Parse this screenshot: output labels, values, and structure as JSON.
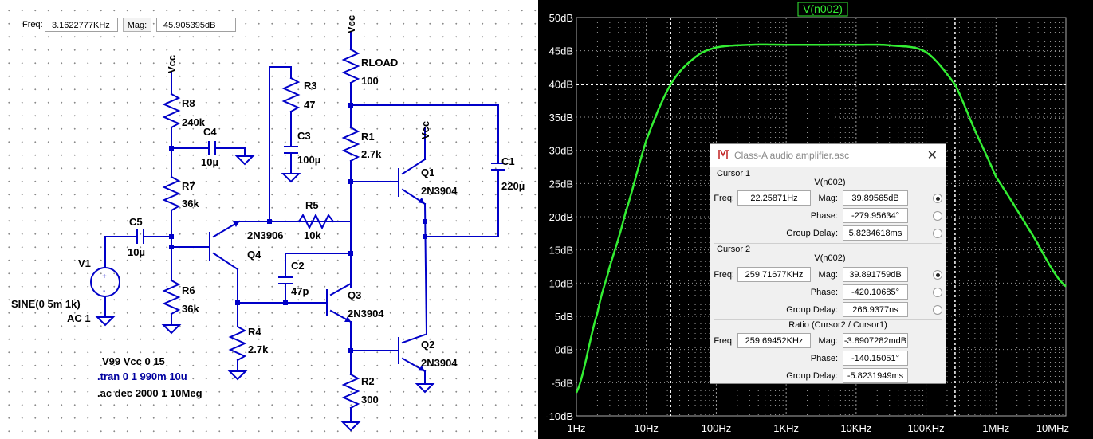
{
  "toolbar": {
    "freq_label": "Freq:",
    "freq_value": "3.1622777KHz",
    "mag_label": "Mag:",
    "mag_value": "45.905395dB"
  },
  "schematic": {
    "labels": {
      "vcc1": "Vcc",
      "vcc2": "Vcc",
      "vcc3": "Vcc",
      "r8": "R8",
      "r8v": "240k",
      "c4": "C4",
      "c4v": "10µ",
      "r7": "R7",
      "r7v": "36k",
      "r6": "R6",
      "r6v": "36k",
      "c5": "C5",
      "c5v": "10µ",
      "v1": "V1",
      "v1s": "SINE(0 5m 1k)",
      "v1a": "AC 1",
      "q4": "Q4",
      "q4m": "2N3906",
      "r4": "R4",
      "r4v": "2.7k",
      "r3": "R3",
      "r3v": "47",
      "c3": "C3",
      "c3v": "100µ",
      "r5": "R5",
      "r5v": "10k",
      "c2": "C2",
      "c2v": "47p",
      "rload": "RLOAD",
      "rloadv": "100",
      "r1": "R1",
      "r1v": "2.7k",
      "q1": "Q1",
      "q1m": "2N3904",
      "q3": "Q3",
      "q3m": "2N3904",
      "q2": "Q2",
      "q2m": "2N3904",
      "r2": "R2",
      "r2v": "300",
      "c1": "C1",
      "c1v": "220µ"
    },
    "directives": {
      "supply": "V99 Vcc 0 15",
      "tran": ".tran 0 1 990m 10u",
      "ac": ".ac dec 2000 1 10Meg"
    }
  },
  "plot": {
    "trace_label": "V(n002)",
    "y_ticks": [
      "50dB",
      "45dB",
      "40dB",
      "35dB",
      "30dB",
      "25dB",
      "20dB",
      "15dB",
      "10dB",
      "5dB",
      "0dB",
      "-5dB",
      "-10dB"
    ],
    "x_ticks": [
      "1Hz",
      "10Hz",
      "100Hz",
      "1KHz",
      "10KHz",
      "100KHz",
      "1MHz",
      "10MHz"
    ],
    "colors": {
      "background": "#000000",
      "trace": "#33ee33",
      "grid": "#9a9a9a",
      "cursor": "#ffffff"
    }
  },
  "chart_data": {
    "type": "line",
    "xscale": "log",
    "xlim": [
      1,
      10000000
    ],
    "ylim": [
      -10,
      50
    ],
    "series": [
      {
        "name": "V(n002)",
        "x": [
          1,
          2,
          3,
          5,
          10,
          22.26,
          50,
          100,
          316.2,
          1000,
          3162,
          10000,
          31620,
          100000,
          259700.0,
          500000,
          1000000,
          3000000,
          10000000
        ],
        "y": [
          -6.5,
          5.5,
          12.5,
          20.5,
          31.5,
          39.9,
          44.0,
          45.5,
          45.9,
          45.9,
          45.9,
          45.9,
          45.8,
          44.8,
          39.9,
          33.0,
          26.0,
          18.0,
          9.5
        ]
      }
    ],
    "cursors": [
      {
        "x": 22.25871,
        "y": 39.89565
      },
      {
        "x": 259716.77,
        "y": 39.891759
      }
    ]
  },
  "cursor_dialog": {
    "title": "Class-A audio amplifier.asc",
    "cursor1": {
      "heading": "Cursor 1",
      "trace": "V(n002)",
      "freq_label": "Freq:",
      "freq": "22.25871Hz",
      "mag_label": "Mag:",
      "mag": "39.89565dB",
      "phase_label": "Phase:",
      "phase": "-279.95634°",
      "gd_label": "Group Delay:",
      "gd": "5.8234618ms"
    },
    "cursor2": {
      "heading": "Cursor 2",
      "trace": "V(n002)",
      "freq_label": "Freq:",
      "freq": "259.71677KHz",
      "mag_label": "Mag:",
      "mag": "39.891759dB",
      "phase_label": "Phase:",
      "phase": "-420.10685°",
      "gd_label": "Group Delay:",
      "gd": "266.9377ns"
    },
    "ratio": {
      "heading": "Ratio (Cursor2 / Cursor1)",
      "freq_label": "Freq:",
      "freq": "259.69452KHz",
      "mag_label": "Mag:",
      "mag": "-3.8907282mdB",
      "phase_label": "Phase:",
      "phase": "-140.15051°",
      "gd_label": "Group Delay:",
      "gd": "-5.8231949ms"
    }
  }
}
